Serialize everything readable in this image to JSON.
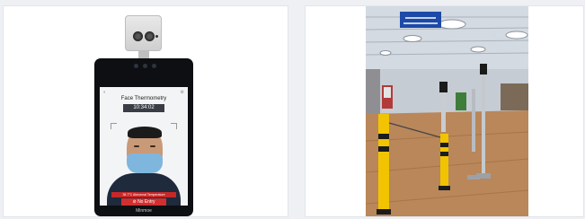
{
  "left_card": {
    "device": {
      "screen_title": "Face Thermometry",
      "time": "10:34:02",
      "warning_text": "35.7°C Abnormal Temperature",
      "no_entry_label": "No Entry",
      "brand": "Minmoe"
    }
  },
  "right_card": {
    "photo": {
      "sign_line1": "",
      "sign_line2": ""
    }
  },
  "colors": {
    "page_bg": "#eef0f4",
    "card_bg": "#ffffff",
    "alert_red": "#d32f2f",
    "bollard_yellow": "#f2c300",
    "floor_wood": "#b9875a",
    "sign_blue": "#1d4aa8"
  }
}
